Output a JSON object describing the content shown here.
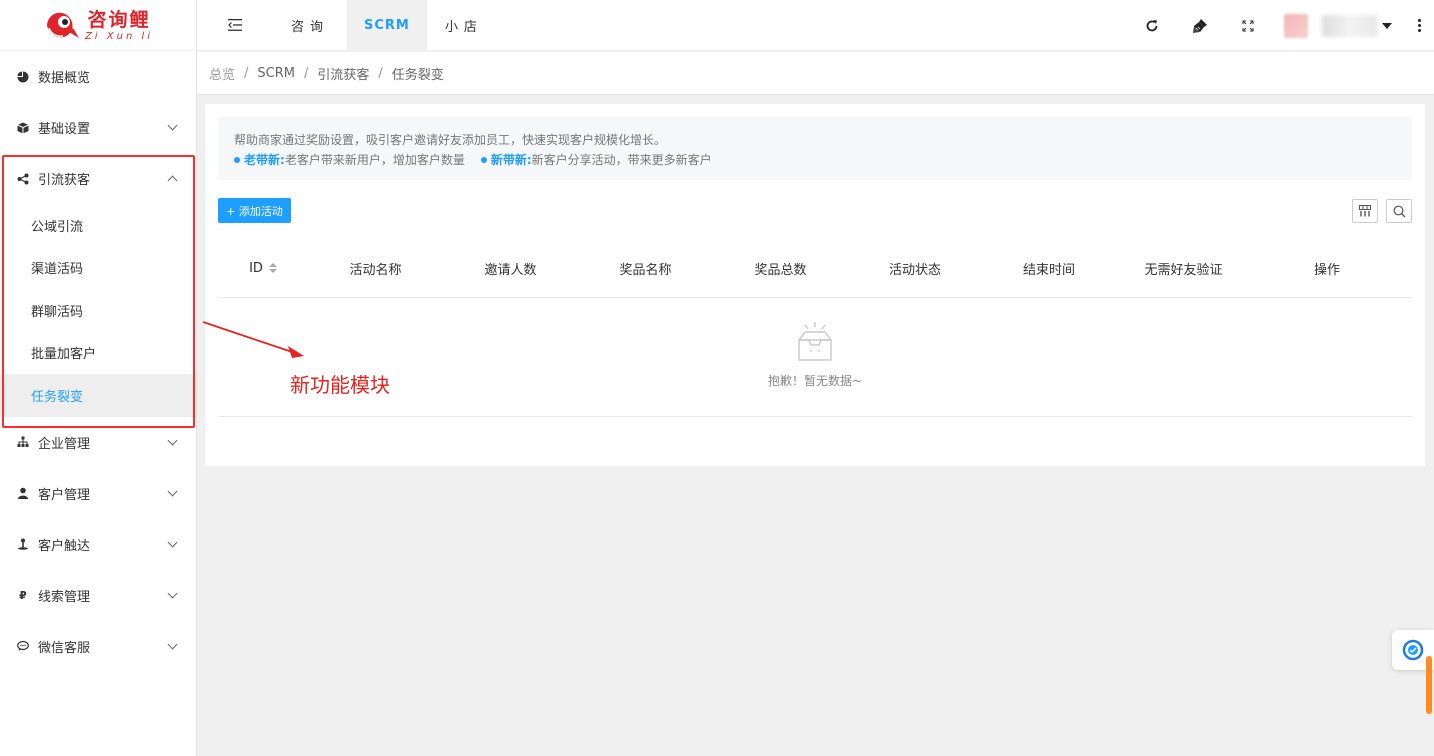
{
  "logo": {
    "cn": "咨询鲤",
    "pinyin": "Zi Xun li"
  },
  "sidebar": {
    "items": [
      {
        "label": "数据概览",
        "icon": "pie-chart-icon"
      },
      {
        "label": "基础设置",
        "icon": "cube-icon"
      },
      {
        "label": "引流获客",
        "icon": "share-icon",
        "expanded": true,
        "children": [
          "公域引流",
          "渠道活码",
          "群聊活码",
          "批量加客户",
          "任务裂变"
        ],
        "active_child": "任务裂变"
      },
      {
        "label": "企业管理",
        "icon": "org-chart-icon"
      },
      {
        "label": "客户管理",
        "icon": "user-icon"
      },
      {
        "label": "客户触达",
        "icon": "reach-icon"
      },
      {
        "label": "线索管理",
        "icon": "yuan-icon"
      },
      {
        "label": "微信客服",
        "icon": "chat-icon"
      }
    ]
  },
  "topbar": {
    "tabs": [
      {
        "label": "咨询"
      },
      {
        "label": "SCRM",
        "active": true
      },
      {
        "label": "小店"
      }
    ]
  },
  "breadcrumb": [
    "总览",
    "SCRM",
    "引流获客",
    "任务裂变"
  ],
  "tip": {
    "line1": "帮助商家通过奖励设置，吸引客户邀请好友添加员工，快速实现客户规模化增长。",
    "old_label": "老带新:",
    "old_text": "老客户带来新用户，增加客户数量",
    "new_label": "新带新:",
    "new_text": "新客户分享活动，带来更多新客户"
  },
  "add_button": "+ 添加活动",
  "table": {
    "columns": [
      "ID",
      "活动名称",
      "邀请人数",
      "奖品名称",
      "奖品总数",
      "活动状态",
      "结束时间",
      "无需好友验证",
      "操作"
    ],
    "empty_text": "抱歉！暂无数据~"
  },
  "annotation": "新功能模块",
  "colors": {
    "accent": "#1e9fff",
    "brand": "#e0242b",
    "annotation": "#e8231e"
  }
}
